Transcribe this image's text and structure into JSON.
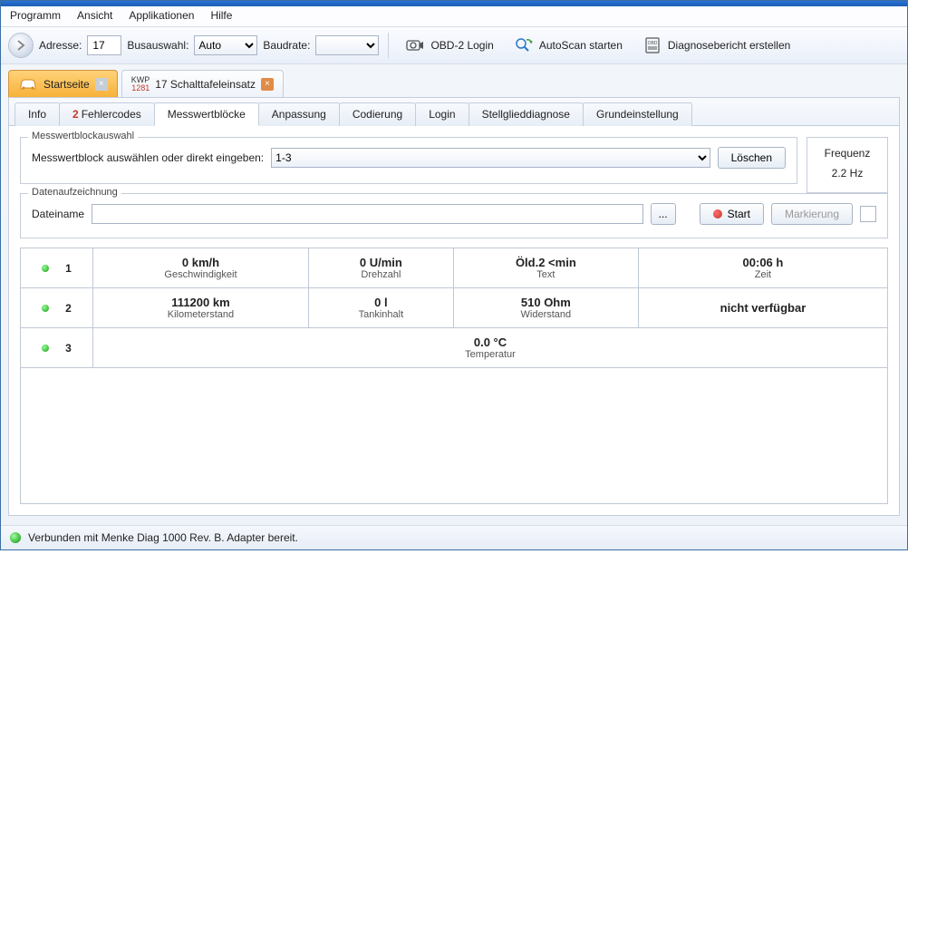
{
  "menu": {
    "programm": "Programm",
    "ansicht": "Ansicht",
    "applikationen": "Applikationen",
    "hilfe": "Hilfe"
  },
  "toolbar": {
    "adresse_label": "Adresse:",
    "adresse_value": "17",
    "busauswahl_label": "Busauswahl:",
    "busauswahl_value": "Auto",
    "baudrate_label": "Baudrate:",
    "obd_login": "OBD-2 Login",
    "autoscan": "AutoScan starten",
    "diagbericht": "Diagnosebericht erstellen"
  },
  "tabs": {
    "startseite": "Startseite",
    "kwp": "KWP",
    "kwp_num": "1281",
    "ecu": "17 Schalttafeleinsatz"
  },
  "subtabs": {
    "info": "Info",
    "fehler_n": "2",
    "fehler": "Fehlercodes",
    "messwert": "Messwertblöcke",
    "anpassung": "Anpassung",
    "codierung": "Codierung",
    "login": "Login",
    "stellglied": "Stellglieddiagnose",
    "grund": "Grundeinstellung"
  },
  "mwb": {
    "legend": "Messwertblockauswahl",
    "label": "Messwertblock auswählen oder direkt eingeben:",
    "value": "1-3",
    "loeschen": "Löschen",
    "freq_legend": "Frequenz",
    "freq_value": "2.2  Hz"
  },
  "rec": {
    "legend": "Datenaufzeichnung",
    "dateiname": "Dateiname",
    "browse": "...",
    "start": "Start",
    "mark": "Markierung"
  },
  "data": {
    "rows": [
      {
        "idx": "1",
        "c1v": "0 km/h",
        "c1l": "Geschwindigkeit",
        "c2v": "0 U/min",
        "c2l": "Drehzahl",
        "c3v": "Öld.2 <min",
        "c3l": "Text",
        "c4v": "00:06 h",
        "c4l": "Zeit"
      },
      {
        "idx": "2",
        "c1v": "111200 km",
        "c1l": "Kilometerstand",
        "c2v": "0 l",
        "c2l": "Tankinhalt",
        "c3v": "510 Ohm",
        "c3l": "Widerstand",
        "c4v": "nicht verfügbar",
        "c4l": ""
      },
      {
        "idx": "3",
        "span_v": "0.0 °C",
        "span_l": "Temperatur"
      }
    ]
  },
  "status": "Verbunden mit Menke Diag 1000 Rev. B. Adapter bereit."
}
